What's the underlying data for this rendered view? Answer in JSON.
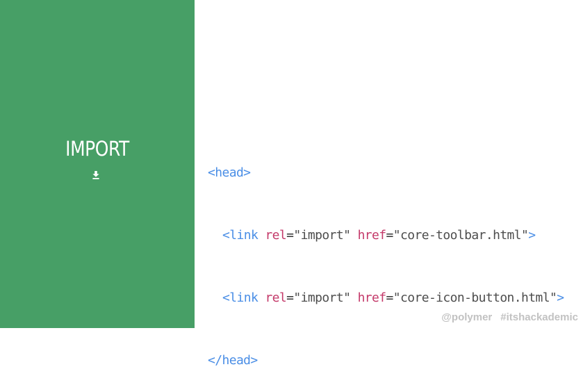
{
  "slide": {
    "title": "IMPORT",
    "icon": "download-icon"
  },
  "code": {
    "lines": [
      {
        "tag_open": "<head>"
      },
      {
        "tag": "<link",
        "attr1": "rel",
        "eq1": "=",
        "val1": "\"import\"",
        "attr2": "href",
        "eq2": "=",
        "val2": "\"core-toolbar.html\"",
        "close": ">"
      },
      {
        "tag": "<link",
        "attr1": "rel",
        "eq1": "=",
        "val1": "\"import\"",
        "attr2": "href",
        "eq2": "=",
        "val2": "\"core-icon-button.html\"",
        "close": ">"
      },
      {
        "tag_close": "</head>"
      }
    ]
  },
  "footer": {
    "handle": "@polymer",
    "hashtag": "#itshackademic"
  },
  "colors": {
    "sidebar_bg": "#479f66",
    "tag": "#4a8ee6",
    "attr": "#c43a6a",
    "footer_text": "#c2c2c2"
  }
}
